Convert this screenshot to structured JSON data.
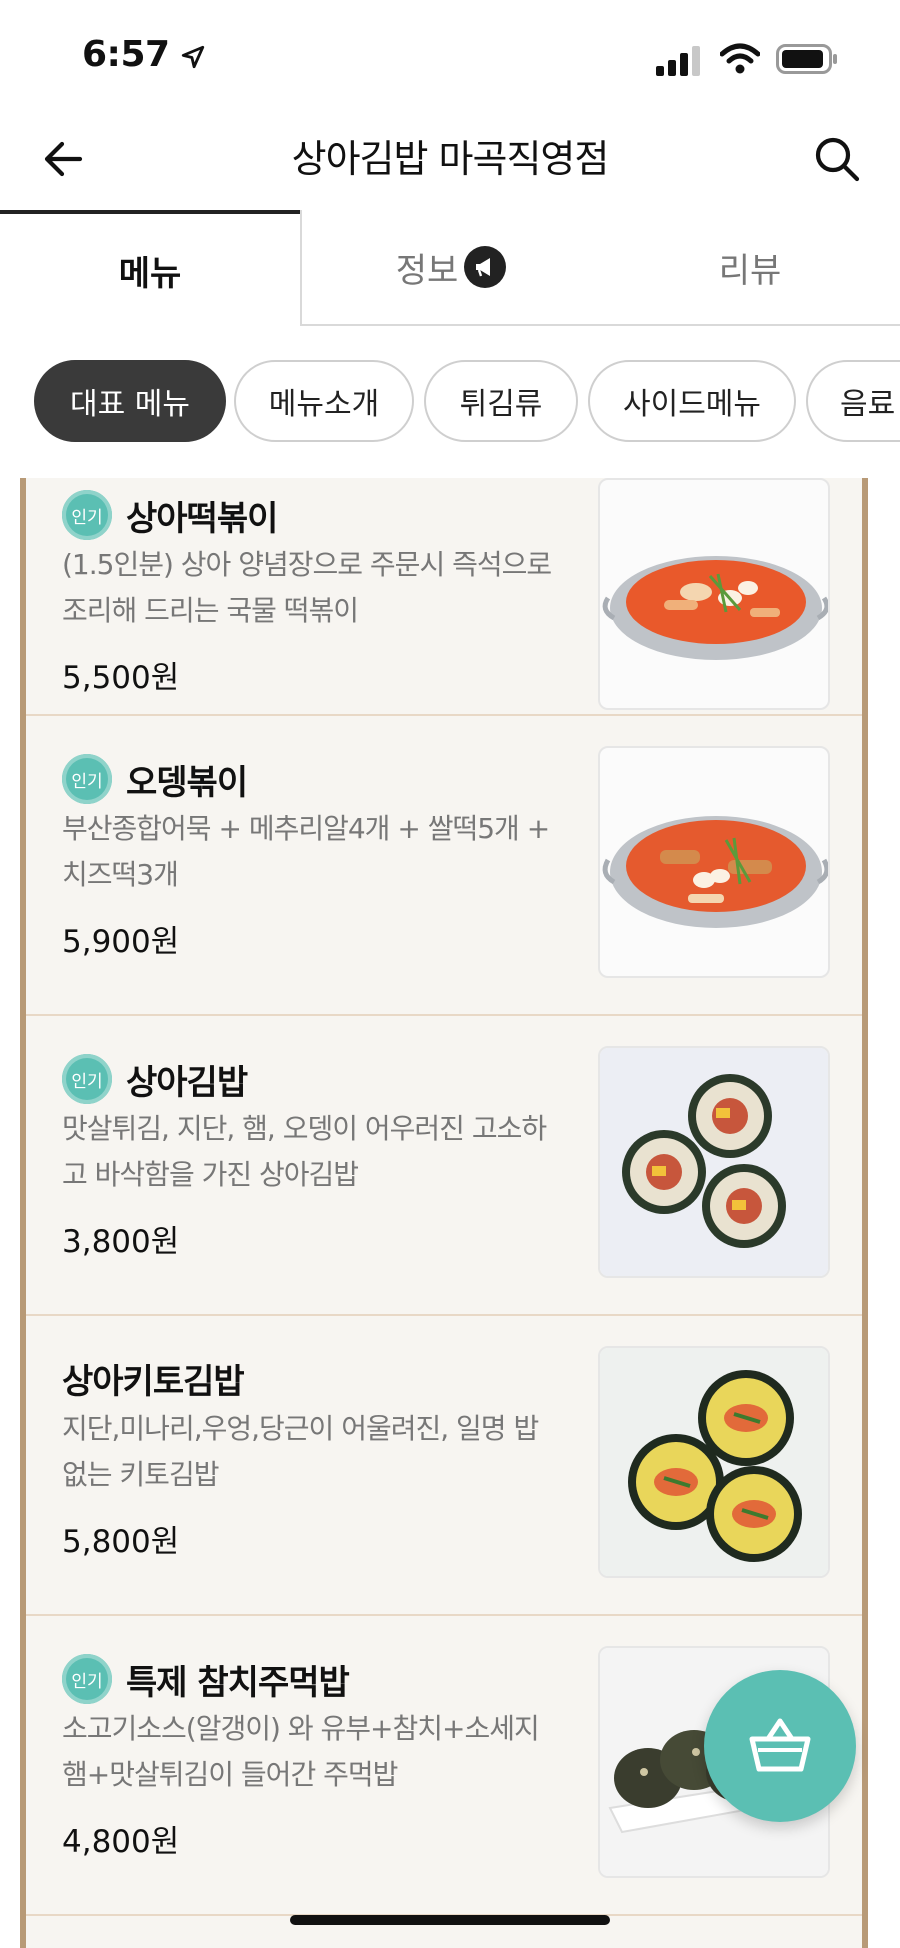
{
  "status": {
    "time": "6:57"
  },
  "header": {
    "title": "상아김밥 마곡직영점"
  },
  "tabs": [
    {
      "label": "메뉴"
    },
    {
      "label": "정보"
    },
    {
      "label": "리뷰"
    }
  ],
  "categories": [
    {
      "label": "대표 메뉴",
      "selected": true
    },
    {
      "label": "메뉴소개"
    },
    {
      "label": "튀김류"
    },
    {
      "label": "사이드메뉴"
    },
    {
      "label": "음료"
    }
  ],
  "badge_label": "인기",
  "menu": [
    {
      "name": "상아떡볶이",
      "popular": true,
      "desc": "(1.5인분) 상아 양념장으로 주문시 즉석으로 조리해 드리는 국물 떡볶이",
      "price": "5,500원",
      "image": "tteokbokki-pot"
    },
    {
      "name": "오뎅볶이",
      "popular": true,
      "desc": "부산종합어묵 + 메추리알4개 + 쌀떡5개 + 치즈떡3개",
      "price": "5,900원",
      "image": "odeng-pot"
    },
    {
      "name": "상아김밥",
      "popular": true,
      "desc": "맛살튀김, 지단, 햄, 오뎅이 어우러진 고소하고 바삭함을 가진 상아김밥",
      "price": "3,800원",
      "image": "gimbap"
    },
    {
      "name": "상아키토김밥",
      "popular": false,
      "desc": "지단,미나리,우엉,당근이 어울려진, 일명 밥 없는 키토김밥",
      "price": "5,800원",
      "image": "keto-gimbap"
    },
    {
      "name": "특제 참치주먹밥",
      "popular": true,
      "desc": "소고기소스(알갱이) 와 유부+참치+소세지햄+맛살튀김이 들어간 주먹밥",
      "price": "4,800원",
      "image": "rice-balls"
    }
  ],
  "colors": {
    "accent": "#5bbfb3",
    "frame": "#b89a77"
  },
  "icons": {
    "back": "back-arrow-icon",
    "search": "search-icon",
    "cart": "basket-icon",
    "info": "megaphone-icon"
  }
}
